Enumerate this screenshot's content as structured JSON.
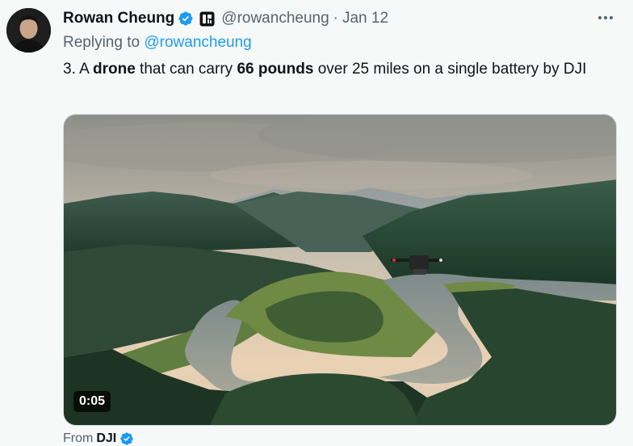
{
  "tweet": {
    "author_name": "Rowan Cheung",
    "handle": "@rowancheung",
    "separator": "·",
    "date": "Jan 12",
    "replying_prefix": "Replying to",
    "replying_handle": "@rowancheung",
    "text_parts": {
      "p1": "3. A ",
      "p2": "drone",
      "p3": " that can carry ",
      "p4": "66 pounds",
      "p5": " over 25 miles on a single battery by DJI"
    },
    "media": {
      "timestamp": "0:05"
    },
    "source_prefix": "From",
    "source_name": "DJI"
  },
  "icons": {
    "verified": "verified-badge-icon",
    "affiliate": "affiliate-badge-icon",
    "more": "more-options-icon"
  },
  "colors": {
    "accent": "#1d9bf0",
    "secondary_text": "#536471",
    "primary_text": "#0f1419",
    "background": "#f7f9f9"
  }
}
